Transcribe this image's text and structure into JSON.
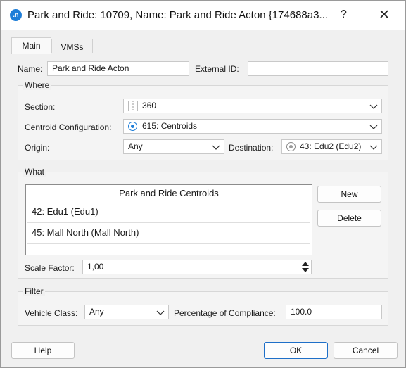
{
  "window": {
    "app_icon": ".n",
    "title": "Park and Ride: 10709, Name: Park and Ride Acton  {174688a3...",
    "help_glyph": "?",
    "close_glyph": "✕"
  },
  "tabs": [
    {
      "label": "Main",
      "active": true
    },
    {
      "label": "VMSs",
      "active": false
    }
  ],
  "main": {
    "name_label": "Name:",
    "name_value": "Park and Ride Acton",
    "external_id_label": "External ID:",
    "external_id_value": ""
  },
  "where": {
    "title": "Where",
    "section_label": "Section:",
    "section_value": "360",
    "centroid_config_label": "Centroid Configuration:",
    "centroid_config_value": "615: Centroids",
    "origin_label": "Origin:",
    "origin_value": "Any",
    "destination_label": "Destination:",
    "destination_value": "43: Edu2 (Edu2)"
  },
  "what": {
    "title": "What",
    "list_header": "Park and Ride Centroids",
    "items": [
      "42: Edu1 (Edu1)",
      "45: Mall North (Mall North)"
    ],
    "new_button": "New",
    "delete_button": "Delete",
    "scale_factor_label": "Scale Factor:",
    "scale_factor_value": "1,00"
  },
  "filter": {
    "title": "Filter",
    "vehicle_class_label": "Vehicle Class:",
    "vehicle_class_value": "Any",
    "compliance_label": "Percentage of Compliance:",
    "compliance_value": "100.0"
  },
  "footer": {
    "help_button": "Help",
    "ok_button": "OK",
    "cancel_button": "Cancel"
  },
  "colors": {
    "accent": "#1e7ed8",
    "background": "#f0f0f0"
  }
}
